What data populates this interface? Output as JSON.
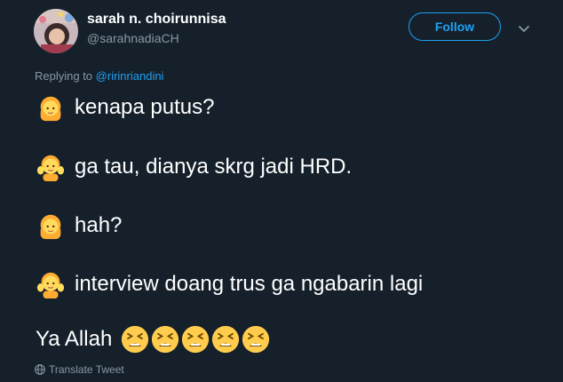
{
  "author": {
    "display_name": "sarah n. choirunnisa",
    "handle": "@sarahnadiaCH",
    "avatar_icon": "profile-photo"
  },
  "follow_button": {
    "label": "Follow"
  },
  "more_menu": {
    "icon": "chevron-down-icon"
  },
  "reply_context": {
    "prefix": "Replying to",
    "mention": "@ririnriandini"
  },
  "tweet_lines": [
    {
      "icon": "person-raising-hand-emoji",
      "text": "kenapa putus?"
    },
    {
      "icon": "person-raising-hand-emoji",
      "text": "ga tau, dianya skrg jadi HRD."
    },
    {
      "icon": "person-raising-hand-emoji",
      "text": "hah?"
    },
    {
      "icon": "person-raising-hand-emoji",
      "text": "interview doang trus ga ngabarin lagi"
    }
  ],
  "final_line": {
    "text": "Ya Allah",
    "emoji_icon": "tired-face-emoji",
    "emoji_count": 5
  },
  "translate": {
    "label": "Translate Tweet"
  },
  "colors": {
    "background": "#15202b",
    "accent": "#1da1f2",
    "muted": "#8899a6",
    "text": "#ffffff",
    "emoji": "#ffcc4d"
  }
}
